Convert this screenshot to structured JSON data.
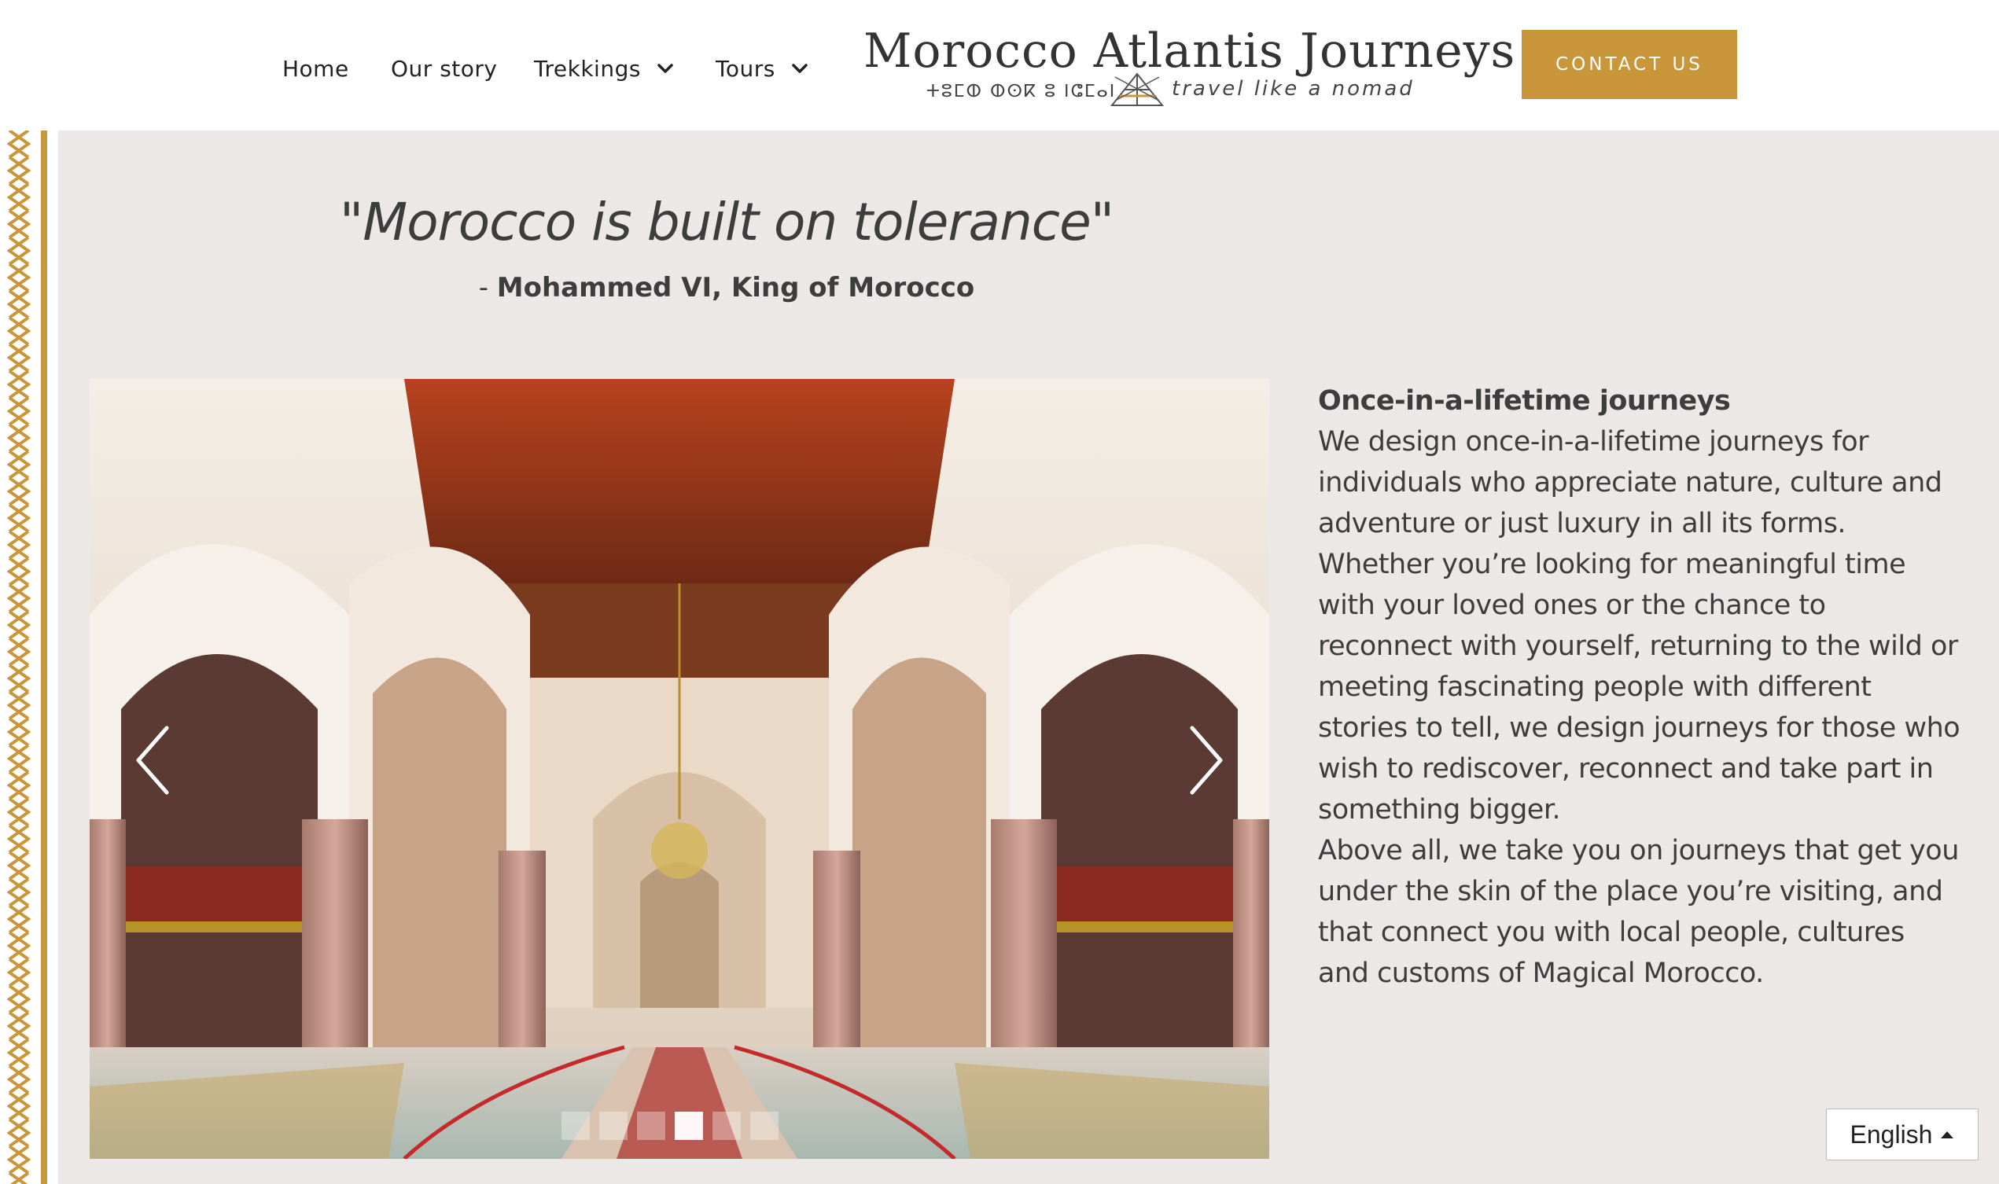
{
  "nav": {
    "home": "Home",
    "our_story": "Our story",
    "trekkings": "Trekkings",
    "tours": "Tours"
  },
  "logo": {
    "title": "Morocco Atlantis Journeys",
    "tifinagh": "ⵜⵓⵎⵀ ⵀⵙⴽ ⵓ ⵏⵛⵎⴰⵏ",
    "tagline": "travel like a nomad"
  },
  "contact_button": "CONTACT US",
  "quote": {
    "text": "\"Morocco is built on tolerance\"",
    "dash": "- ",
    "author": "Mohammed VI, King of Morocco"
  },
  "slider": {
    "slide_count": 6,
    "active_index": 3
  },
  "content": {
    "heading": "Once-in-a-lifetime journeys",
    "paragraph1": "We design once-in-a-lifetime journeys for individuals who appreciate nature, culture and adventure or just luxury in all its forms. Whether you’re looking for meaningful time with your loved ones or the chance to reconnect with yourself, returning to the wild or meeting fascinating people with different stories to tell, we design journeys for those who wish to rediscover, reconnect and take part in something bigger.",
    "paragraph2": "Above all, we take you on journeys that get you under the skin of the place you’re visiting, and that connect you with local people, cultures and customs of Magical Morocco."
  },
  "language": {
    "selected": "English"
  },
  "colors": {
    "accent": "#c99639",
    "background": "#ede8e8",
    "text": "#3d3d3d"
  },
  "icons": {
    "dropdown": "chevron-down-icon",
    "prev": "chevron-left-icon",
    "next": "chevron-right-icon",
    "language_caret": "caret-up-icon"
  }
}
